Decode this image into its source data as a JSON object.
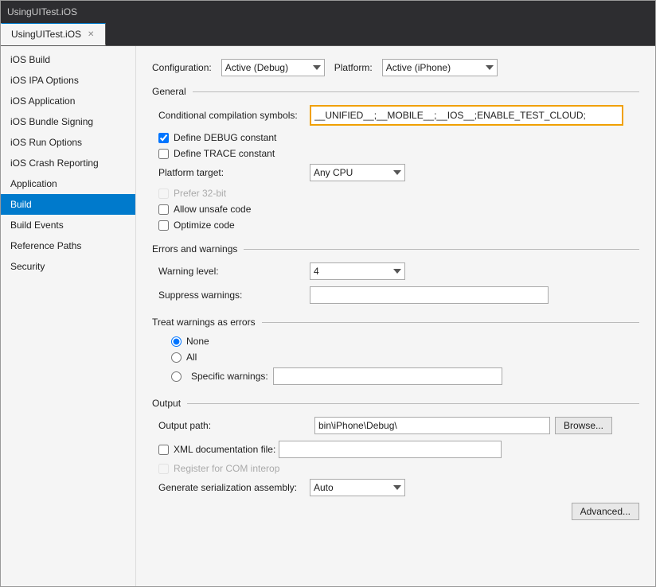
{
  "window": {
    "title": "UsingUITest.iOS"
  },
  "tab": {
    "label": "UsingUITest.iOS",
    "close_icon": "✕"
  },
  "sidebar": {
    "items": [
      {
        "id": "ios-build",
        "label": "iOS Build"
      },
      {
        "id": "ios-ipa-options",
        "label": "iOS IPA Options"
      },
      {
        "id": "ios-application",
        "label": "iOS Application"
      },
      {
        "id": "ios-bundle-signing",
        "label": "iOS Bundle Signing"
      },
      {
        "id": "ios-run-options",
        "label": "iOS Run Options"
      },
      {
        "id": "ios-crash-reporting",
        "label": "iOS Crash Reporting"
      },
      {
        "id": "application",
        "label": "Application"
      },
      {
        "id": "build",
        "label": "Build",
        "active": true
      },
      {
        "id": "build-events",
        "label": "Build Events"
      },
      {
        "id": "reference-paths",
        "label": "Reference Paths"
      },
      {
        "id": "security",
        "label": "Security"
      }
    ]
  },
  "main": {
    "configuration_label": "Configuration:",
    "configuration_value": "Active (Debug)",
    "platform_label": "Platform:",
    "platform_value": "Active (iPhone)",
    "sections": {
      "general": {
        "title": "General",
        "ccs_label": "Conditional compilation symbols:",
        "ccs_value": "__UNIFIED__;__MOBILE__;__IOS__;ENABLE_TEST_CLOUD;",
        "define_debug_label": "Define DEBUG constant",
        "define_debug_checked": true,
        "define_trace_label": "Define TRACE constant",
        "define_trace_checked": false,
        "platform_target_label": "Platform target:",
        "platform_target_value": "Any CPU",
        "prefer_32bit_label": "Prefer 32-bit",
        "prefer_32bit_checked": false,
        "prefer_32bit_disabled": true,
        "allow_unsafe_label": "Allow unsafe code",
        "allow_unsafe_checked": false,
        "optimize_label": "Optimize code",
        "optimize_checked": false
      },
      "errors_warnings": {
        "title": "Errors and warnings",
        "warning_level_label": "Warning level:",
        "warning_level_value": "4",
        "suppress_warnings_label": "Suppress warnings:",
        "suppress_warnings_value": ""
      },
      "treat_as_errors": {
        "title": "Treat warnings as errors",
        "options": [
          {
            "id": "none",
            "label": "None",
            "checked": true
          },
          {
            "id": "all",
            "label": "All",
            "checked": false
          },
          {
            "id": "specific",
            "label": "Specific warnings:",
            "checked": false
          }
        ],
        "specific_value": ""
      },
      "output": {
        "title": "Output",
        "output_path_label": "Output path:",
        "output_path_value": "bin\\iPhone\\Debug\\",
        "browse_label": "Browse...",
        "xml_doc_label": "XML documentation file:",
        "xml_doc_checked": false,
        "xml_doc_value": "",
        "com_interop_label": "Register for COM interop",
        "com_interop_checked": false,
        "com_interop_disabled": true,
        "gen_serialization_label": "Generate serialization assembly:",
        "gen_serialization_value": "Auto",
        "advanced_label": "Advanced..."
      }
    }
  }
}
